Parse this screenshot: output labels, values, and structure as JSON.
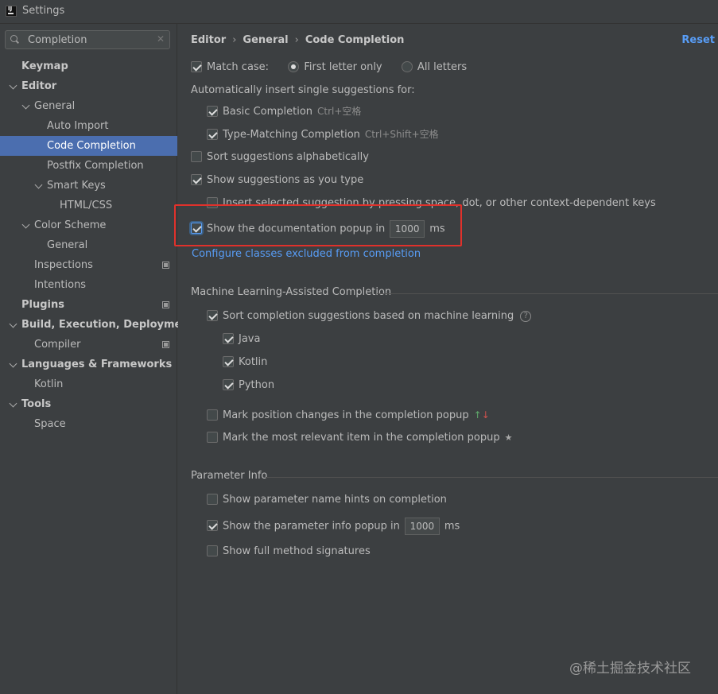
{
  "window": {
    "title": "Settings"
  },
  "search": {
    "value": "Completion"
  },
  "tree": [
    {
      "label": "Keymap"
    },
    {
      "label": "Editor"
    },
    {
      "label": "General"
    },
    {
      "label": "Auto Import"
    },
    {
      "label": "Code Completion",
      "selected": true
    },
    {
      "label": "Postfix Completion"
    },
    {
      "label": "Smart Keys"
    },
    {
      "label": "HTML/CSS"
    },
    {
      "label": "Color Scheme"
    },
    {
      "label": "General"
    },
    {
      "label": "Inspections"
    },
    {
      "label": "Intentions"
    },
    {
      "label": "Plugins"
    },
    {
      "label": "Build, Execution, Deployment"
    },
    {
      "label": "Compiler"
    },
    {
      "label": "Languages & Frameworks"
    },
    {
      "label": "Kotlin"
    },
    {
      "label": "Tools"
    },
    {
      "label": "Space"
    }
  ],
  "breadcrumb": [
    "Editor",
    "General",
    "Code Completion"
  ],
  "reset_label": "Reset",
  "match_case": {
    "label": "Match case:",
    "checked": true,
    "options": [
      "First letter only",
      "All letters"
    ],
    "selected": "First letter only"
  },
  "auto_insert": {
    "heading": "Automatically insert single suggestions for:",
    "basic": {
      "label": "Basic Completion",
      "shortcut": "Ctrl+空格",
      "checked": true
    },
    "type_matching": {
      "label": "Type-Matching Completion",
      "shortcut": "Ctrl+Shift+空格",
      "checked": true
    }
  },
  "sort_alpha": {
    "label": "Sort suggestions alphabetically",
    "checked": false
  },
  "show_as_type": {
    "label": "Show suggestions as you type",
    "checked": true
  },
  "insert_selected": {
    "label": "Insert selected suggestion by pressing space, dot, or other context-dependent keys",
    "checked": false
  },
  "doc_popup": {
    "label": "Show the documentation popup in",
    "value": "1000",
    "unit": "ms",
    "checked": true
  },
  "configure_link": "Configure classes excluded from completion",
  "ml": {
    "title": "Machine Learning-Assisted Completion",
    "sort": {
      "label": "Sort completion suggestions based on machine learning",
      "checked": true
    },
    "langs": [
      {
        "label": "Java",
        "checked": true
      },
      {
        "label": "Kotlin",
        "checked": true
      },
      {
        "label": "Python",
        "checked": true
      }
    ],
    "mark_position": {
      "label": "Mark position changes in the completion popup",
      "checked": false
    },
    "mark_relevant": {
      "label": "Mark the most relevant item in the completion popup",
      "checked": false
    }
  },
  "param_info": {
    "title": "Parameter Info",
    "name_hints": {
      "label": "Show parameter name hints on completion",
      "checked": false
    },
    "info_popup": {
      "label": "Show the parameter info popup in",
      "value": "1000",
      "unit": "ms",
      "checked": true
    },
    "full_signatures": {
      "label": "Show full method signatures",
      "checked": false
    }
  },
  "watermark": "@稀土掘金技术社区",
  "colors": {
    "accent": "#589df6",
    "selection": "#4b6eaf",
    "highlight_box": "#e0312b"
  }
}
